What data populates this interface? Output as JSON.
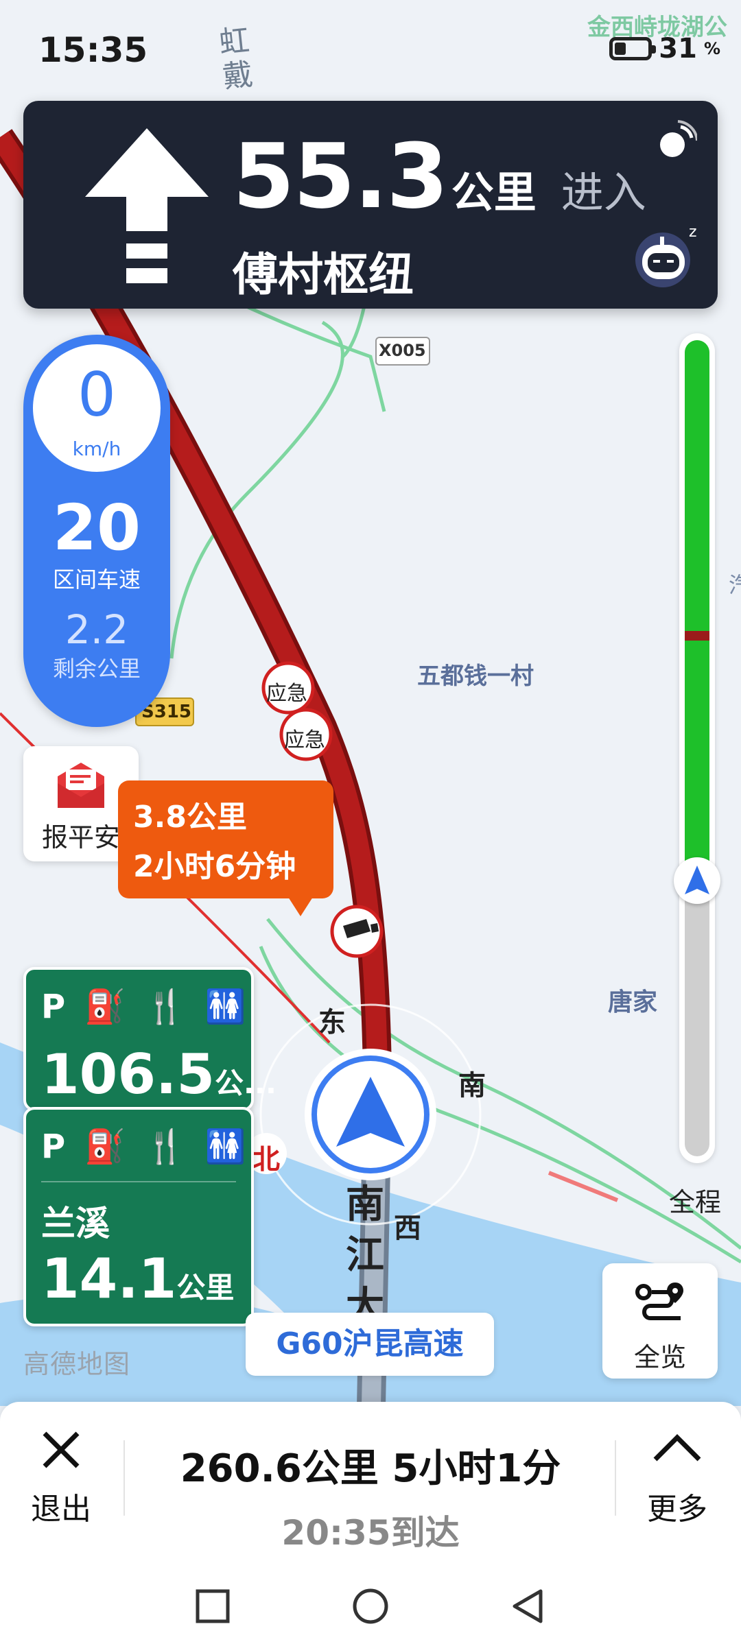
{
  "status_bar": {
    "time": "15:35",
    "battery_level": "31",
    "battery_unit": "%"
  },
  "guidance": {
    "distance": "55.3",
    "distance_unit": "公里",
    "action": "进入",
    "target": "傅村枢纽",
    "maneuver_icon": "straight-arrow-icon"
  },
  "speed": {
    "current": "0",
    "unit": "km/h",
    "interval_speed": "20",
    "interval_label": "区间车速",
    "remaining": "2.2",
    "remaining_label": "剩余公里"
  },
  "safe_button": {
    "label": "报平安"
  },
  "callout": {
    "line1": "3.8公里",
    "line2": "2小时6分钟"
  },
  "service_areas": [
    {
      "icons": [
        "P",
        "⛽",
        "🍴",
        "🚻"
      ],
      "distance": "106.5",
      "distance_suffix": "公..."
    },
    {
      "icons": [
        "P",
        "⛽",
        "🍴",
        "🚻"
      ],
      "name": "兰溪",
      "distance": "14.1",
      "unit": "公里"
    }
  ],
  "map_labels": {
    "top_right": "金西峙垅湖公",
    "top_road": "虹戴",
    "x005": "X005",
    "s315": "S315",
    "village": "五都钱一村",
    "tangjia": "唐家",
    "emergency": "应急",
    "compass_e": "东",
    "compass_s": "南",
    "compass_w": "西",
    "compass_n": "北",
    "road_vertical": "南江大",
    "edge_char": "汽"
  },
  "road_chip": "G60沪昆高速",
  "map_logo": "高德地图",
  "progress": {
    "label": "全程",
    "traffic_fraction": 0.66
  },
  "overview_button": {
    "label": "全览"
  },
  "bottom_bar": {
    "exit_label": "退出",
    "summary": "260.6公里  5小时1分",
    "eta": "20:35到达",
    "more_label": "更多"
  },
  "colors": {
    "nav_panel": "#1e2433",
    "speed_panel": "#3d7df1",
    "callout": "#ee5a0f",
    "service_card": "#157a53",
    "route": "#9b1b1b",
    "progress_green": "#1ec02a"
  }
}
